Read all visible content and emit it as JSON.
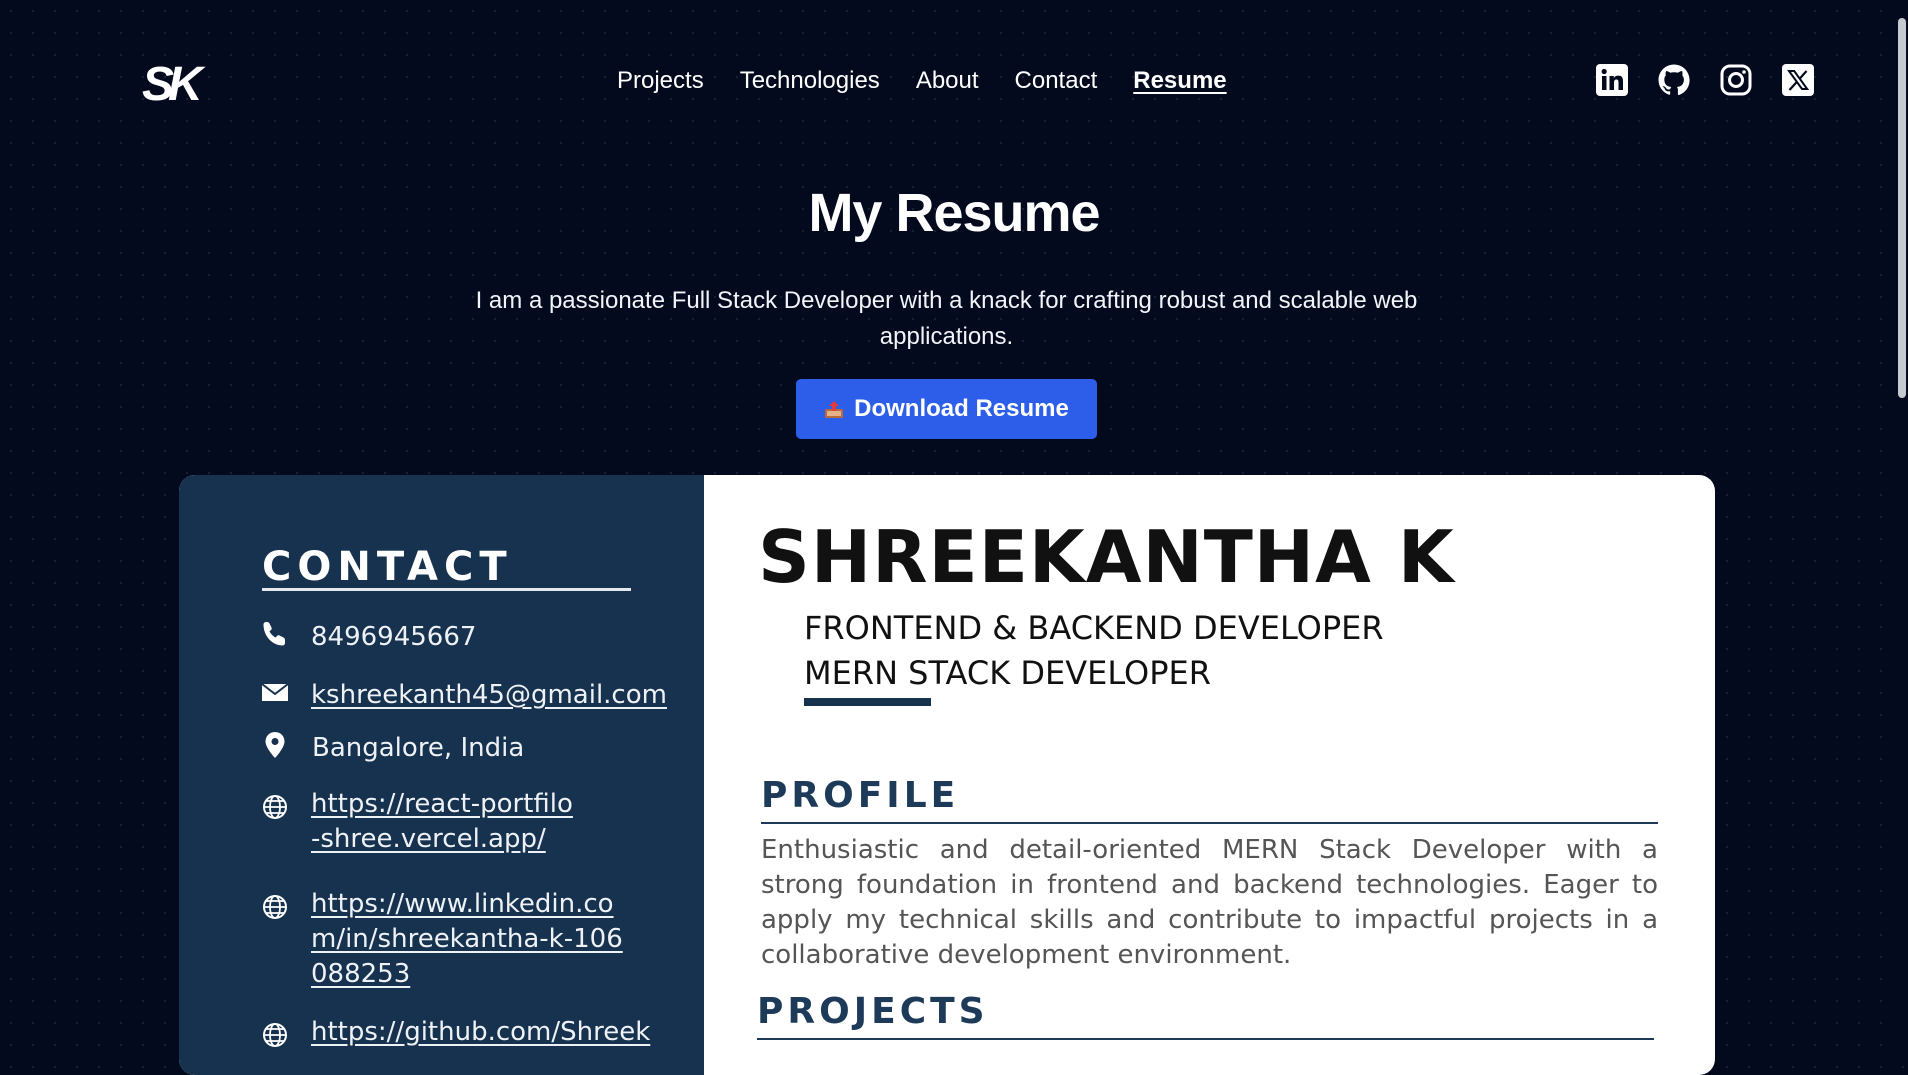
{
  "header": {
    "logo_text": "SK",
    "nav": [
      {
        "label": "Projects"
      },
      {
        "label": "Technologies"
      },
      {
        "label": "About"
      },
      {
        "label": "Contact"
      },
      {
        "label": "Resume",
        "active": true
      }
    ],
    "socials": [
      "linkedin-icon",
      "github-icon",
      "instagram-icon",
      "x-icon"
    ]
  },
  "hero": {
    "title": "My Resume",
    "subtitle": "I am a passionate Full Stack Developer with a knack for crafting robust and scalable web applications.",
    "download_label": "Download Resume",
    "download_icon": "outbox-tray-icon",
    "button_color": "#2d5ee9"
  },
  "resume": {
    "sidebar_color": "#16324f",
    "contact": {
      "heading": "CONTACT",
      "phone": "8496945667",
      "email": "kshreekanth45@gmail.com",
      "location": "Bangalore, India",
      "portfolio": "https://react-portfilo-shree.vercel.app/",
      "linkedin": "https://www.linkedin.com/in/shreekantha-k-106088253",
      "github": "https://github.com/Shreek"
    },
    "name": "SHREEKANTHA K",
    "roles": [
      "FRONTEND & BACKEND DEVELOPER",
      "MERN STACK DEVELOPER"
    ],
    "profile": {
      "heading": "PROFILE",
      "text": "Enthusiastic and detail-oriented MERN Stack Developer with a strong foundation in frontend and backend technologies. Eager to apply my technical skills and contribute to impactful projects in a collaborative development environment."
    },
    "projects": {
      "heading": "PROJECTS"
    }
  }
}
